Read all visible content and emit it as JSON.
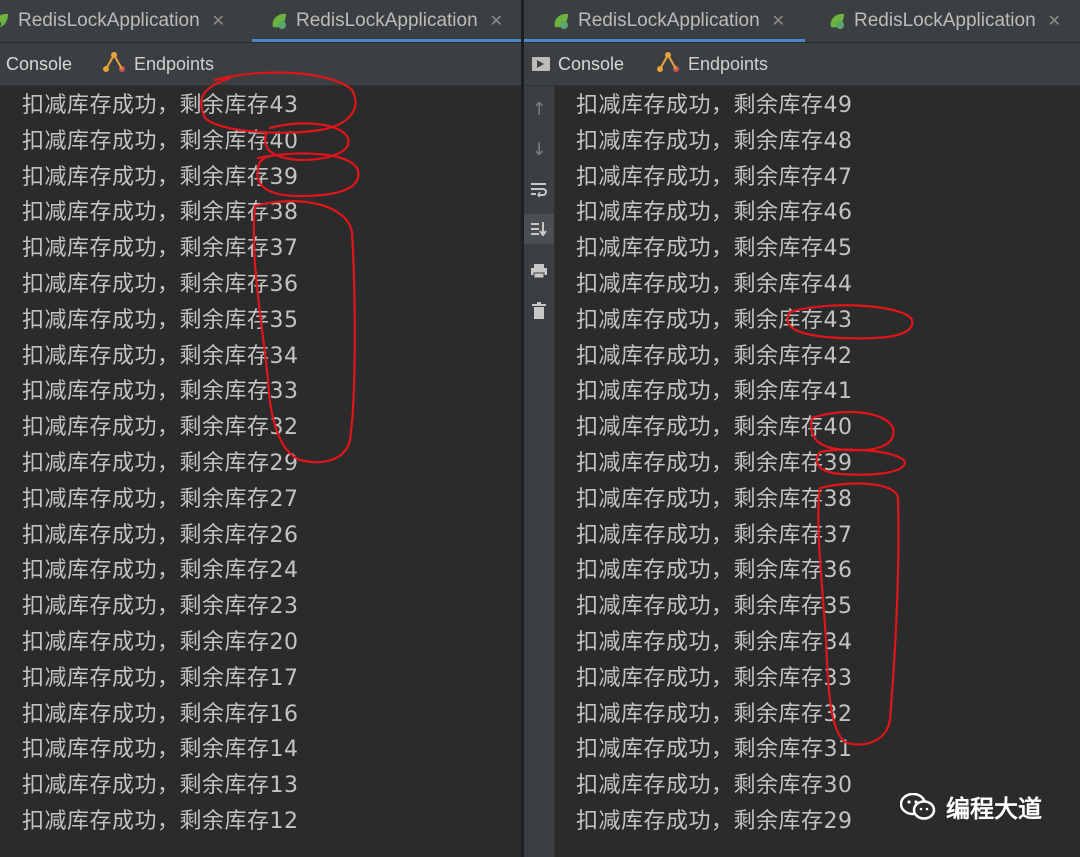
{
  "left_window": {
    "tabs": [
      {
        "label": "RedisLockApplication",
        "active": false
      },
      {
        "label": "RedisLockApplication",
        "active": true
      }
    ],
    "tool_tabs": {
      "console": "Console",
      "endpoints": "Endpoints"
    },
    "console_lines": [
      "扣减库存成功，剩余库存43",
      "扣减库存成功，剩余库存40",
      "扣减库存成功，剩余库存39",
      "扣减库存成功，剩余库存38",
      "扣减库存成功，剩余库存37",
      "扣减库存成功，剩余库存36",
      "扣减库存成功，剩余库存35",
      "扣减库存成功，剩余库存34",
      "扣减库存成功，剩余库存33",
      "扣减库存成功，剩余库存32",
      "扣减库存成功，剩余库存29",
      "扣减库存成功，剩余库存27",
      "扣减库存成功，剩余库存26",
      "扣减库存成功，剩余库存24",
      "扣减库存成功，剩余库存23",
      "扣减库存成功，剩余库存20",
      "扣减库存成功，剩余库存17",
      "扣减库存成功，剩余库存16",
      "扣减库存成功，剩余库存14",
      "扣减库存成功，剩余库存13",
      "扣减库存成功，剩余库存12"
    ]
  },
  "right_window": {
    "tabs": [
      {
        "label": "RedisLockApplication",
        "active": true
      },
      {
        "label": "RedisLockApplication",
        "active": false
      }
    ],
    "tool_tabs": {
      "console": "Console",
      "endpoints": "Endpoints"
    },
    "gutter_icons": [
      "arrow-up-icon",
      "arrow-down-icon",
      "soft-wrap-icon",
      "scroll-to-end-icon",
      "print-icon",
      "trash-icon"
    ],
    "console_lines": [
      "扣减库存成功，剩余库存49",
      "扣减库存成功，剩余库存48",
      "扣减库存成功，剩余库存47",
      "扣减库存成功，剩余库存46",
      "扣减库存成功，剩余库存45",
      "扣减库存成功，剩余库存44",
      "扣减库存成功，剩余库存43",
      "扣减库存成功，剩余库存42",
      "扣减库存成功，剩余库存41",
      "扣减库存成功，剩余库存40",
      "扣减库存成功，剩余库存39",
      "扣减库存成功，剩余库存38",
      "扣减库存成功，剩余库存37",
      "扣减库存成功，剩余库存36",
      "扣减库存成功，剩余库存35",
      "扣减库存成功，剩余库存34",
      "扣减库存成功，剩余库存33",
      "扣减库存成功，剩余库存32",
      "扣减库存成功，剩余库存31",
      "扣减库存成功，剩余库存30",
      "扣减库存成功，剩余库存29"
    ]
  },
  "watermark": {
    "text": "编程大道"
  },
  "colors": {
    "annotation": "#e0141a",
    "tab_underline": "#4a88c7",
    "spring_green": "#6db33f"
  }
}
